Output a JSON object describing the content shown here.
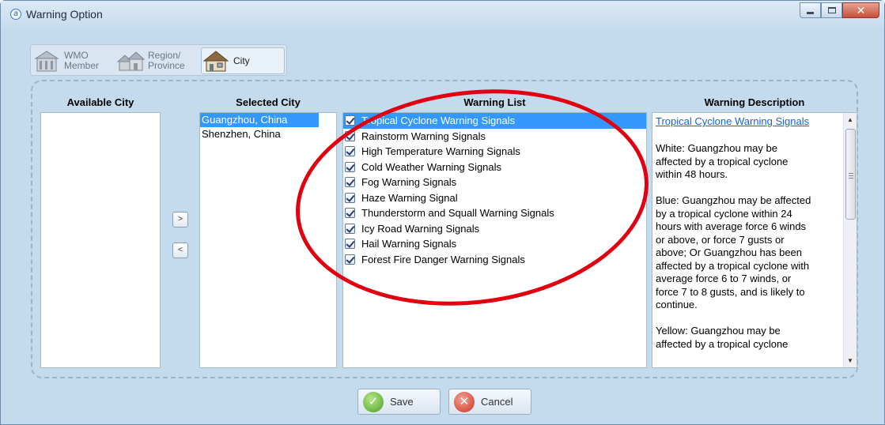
{
  "window": {
    "title": "Warning Option",
    "app_icon_glyph": "a"
  },
  "tabs": [
    {
      "label": "WMO\nMember",
      "icon": "building-icon",
      "active": false
    },
    {
      "label": "Region/\nProvince",
      "icon": "houses-icon",
      "active": false
    },
    {
      "label": "City",
      "icon": "city-house-icon",
      "active": true
    }
  ],
  "columns": {
    "available_city": "Available City",
    "selected_city": "Selected City",
    "warning_list": "Warning List",
    "warning_description": "Warning Description"
  },
  "available_cities": [],
  "selected_cities": [
    {
      "name": "Guangzhou, China",
      "selected": true
    },
    {
      "name": "Shenzhen, China",
      "selected": false
    }
  ],
  "move_buttons": {
    "add": ">",
    "remove": "<"
  },
  "warnings": [
    {
      "label": "Tropical Cyclone Warning Signals",
      "checked": true,
      "selected": true
    },
    {
      "label": "Rainstorm Warning Signals",
      "checked": true,
      "selected": false
    },
    {
      "label": "High Temperature Warning Signals",
      "checked": true,
      "selected": false
    },
    {
      "label": "Cold Weather Warning Signals",
      "checked": true,
      "selected": false
    },
    {
      "label": "Fog Warning Signals",
      "checked": true,
      "selected": false
    },
    {
      "label": "Haze Warning Signal",
      "checked": true,
      "selected": false
    },
    {
      "label": "Thunderstorm and Squall Warning Signals",
      "checked": true,
      "selected": false
    },
    {
      "label": "Icy Road Warning Signals",
      "checked": true,
      "selected": false
    },
    {
      "label": "Hail Warning Signals",
      "checked": true,
      "selected": false
    },
    {
      "label": "Forest Fire Danger Warning Signals",
      "checked": true,
      "selected": false
    }
  ],
  "description": {
    "title": "Tropical Cyclone Warning Signals",
    "text": "White: Guangzhou may be\naffected by a tropical cyclone\nwithin 48 hours.\n\nBlue: Guangzhou may be affected\nby a tropical cyclone within 24\nhours with average force 6 winds\nor above, or force 7 gusts or\nabove; Or Guangzhou has been\naffected by a tropical cyclone with\naverage force 6 to 7 winds, or\nforce 7 to 8 gusts, and is likely to\ncontinue.\n\nYellow: Guangzhou may be\naffected by a tropical cyclone"
  },
  "buttons": {
    "save": "Save",
    "cancel": "Cancel"
  },
  "colors": {
    "window_bg": "#c4dbee",
    "selection": "#3399ff",
    "link": "#1a64c8",
    "annotation_ellipse": "#e0000f"
  }
}
